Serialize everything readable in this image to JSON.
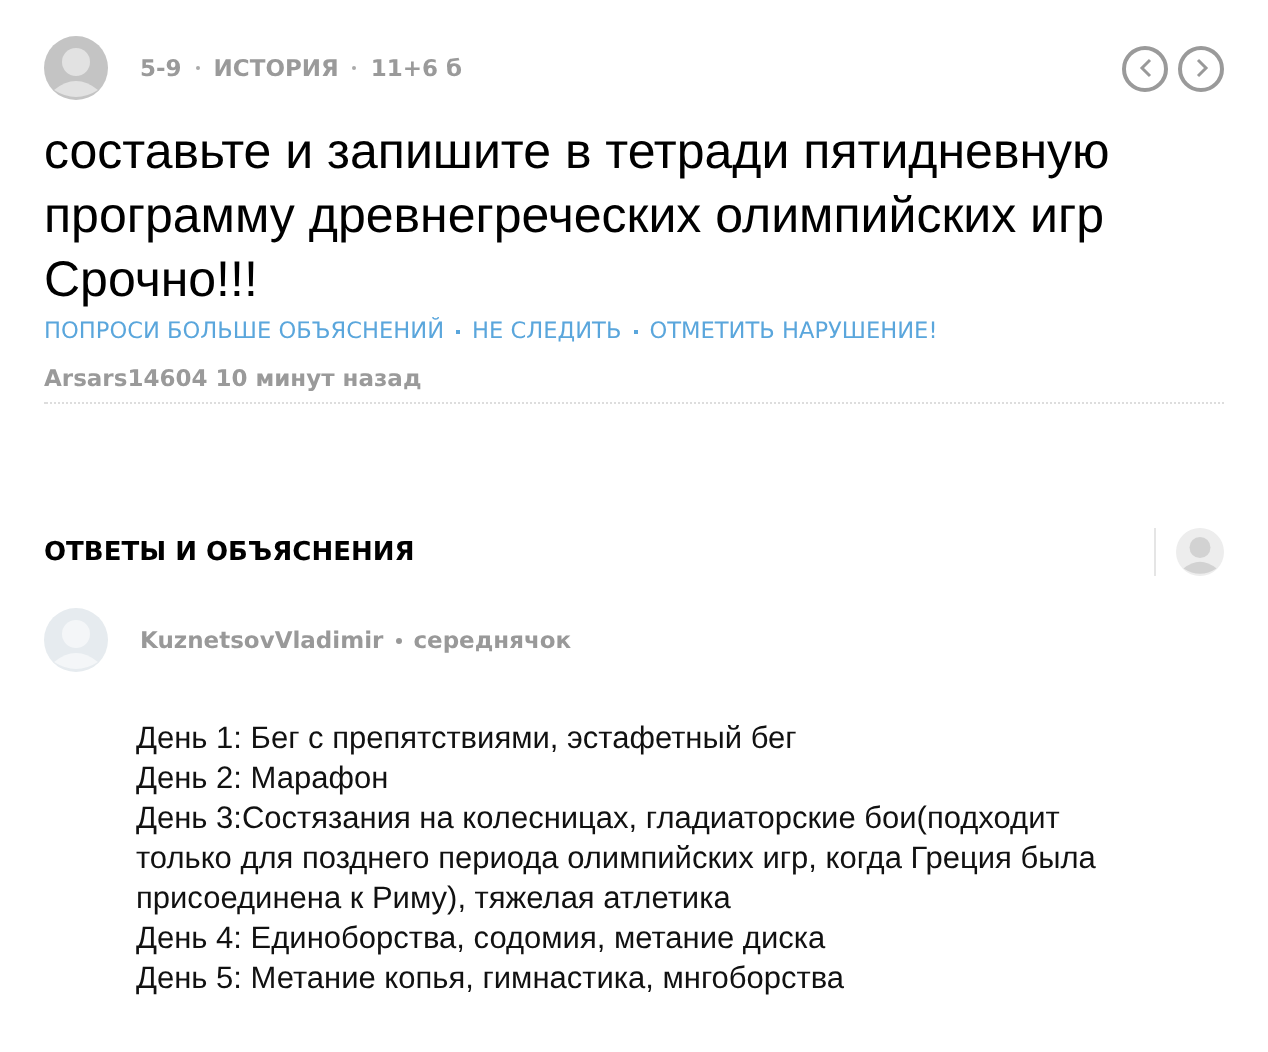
{
  "question": {
    "meta": [
      "5-9",
      "ИСТОРИЯ",
      "11+6 б"
    ],
    "title": "составьте и запишите в тетради пятидневную программу древнегреческих олимпийских игр Срочно!!!",
    "actions": [
      "ПОПРОСИ БОЛЬШЕ ОБЪЯСНЕНИЙ",
      "НЕ СЛЕДИТЬ",
      "ОТМЕТИТЬ НАРУШЕНИЕ!"
    ],
    "author": "Arsars14604",
    "time": "10 минут назад"
  },
  "answers": {
    "heading": "ОТВЕТЫ И ОБЪЯСНЕНИЯ",
    "author": "KuznetsovVladimir",
    "rank": "середнячок",
    "lines": [
      "День 1: Бег с препятствиями, эстафетный бег",
      "День 2: Марафон",
      "День 3:Состязания на колесницах, гладиаторские бои(подходит только для позднего периода олимпийских игр, когда Греция была присоединена к Риму), тяжелая атлетика",
      "День 4: Единоборства, содомия, метание диска",
      "День 5: Метание копья, гимнастика, мнгоборства"
    ]
  }
}
